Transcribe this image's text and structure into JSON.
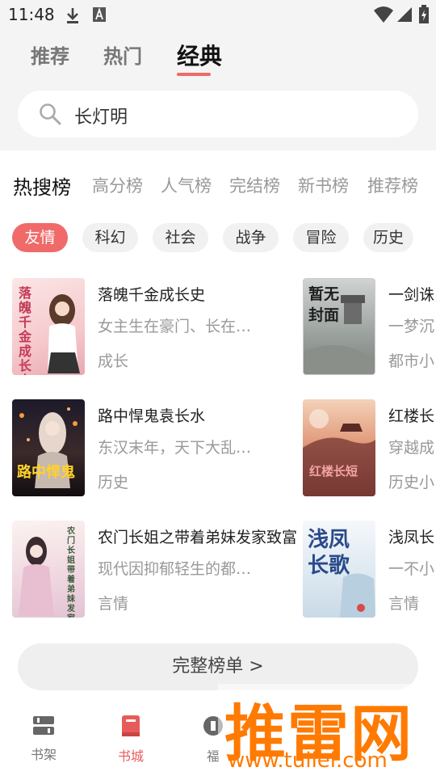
{
  "status_bar": {
    "time": "11:48",
    "icons": [
      "download-icon",
      "app-a-icon",
      "wifi-icon",
      "signal-icon",
      "battery-icon"
    ]
  },
  "tabs": [
    {
      "label": "推荐"
    },
    {
      "label": "热门"
    },
    {
      "label": "经典",
      "active": true
    }
  ],
  "search": {
    "value": "长灯明",
    "icon": "search-icon"
  },
  "rank_tabs": [
    {
      "label": "热搜榜",
      "active": true
    },
    {
      "label": "高分榜"
    },
    {
      "label": "人气榜"
    },
    {
      "label": "完结榜"
    },
    {
      "label": "新书榜"
    },
    {
      "label": "推荐榜"
    }
  ],
  "chips": [
    {
      "label": "友情",
      "active": true
    },
    {
      "label": "科幻"
    },
    {
      "label": "社会"
    },
    {
      "label": "战争"
    },
    {
      "label": "冒险"
    },
    {
      "label": "历史"
    }
  ],
  "books": [
    {
      "title": "落魄千金成长史",
      "desc": "女主生在豪门、长在…",
      "tag": "成长",
      "cover_text": "落魄千金成长史"
    },
    {
      "title": "一剑诛",
      "desc": "一梦沉",
      "tag": "都市小",
      "cover_text": "暂无封面"
    },
    {
      "title": "路中悍鬼袁长水",
      "desc": "东汉末年，天下大乱…",
      "tag": "历史",
      "cover_text": "路中悍鬼"
    },
    {
      "title": "红楼长",
      "desc": "穿越成",
      "tag": "历史小",
      "cover_text": "红楼长短"
    },
    {
      "title": "农门长姐之带着弟妹发家致富",
      "desc": "现代因抑郁轻生的都…",
      "tag": "言情",
      "cover_text": "农门长姐带着弟妹发家致富"
    },
    {
      "title": "浅凤长",
      "desc": "一不小",
      "tag": "言情",
      "cover_text": "浅凤长歌"
    }
  ],
  "full_list_button": "完整榜单 >",
  "bottom_nav": [
    {
      "label": "书架",
      "icon": "bookshelf-icon"
    },
    {
      "label": "书城",
      "icon": "bookstore-icon",
      "active": true
    },
    {
      "label": "福",
      "icon": "welfare-icon"
    }
  ],
  "watermark": {
    "logo": "推雷网",
    "url": "www.tuilei.com"
  },
  "colors": {
    "accent": "#f06a6a",
    "watermark": "#ff7a00"
  }
}
